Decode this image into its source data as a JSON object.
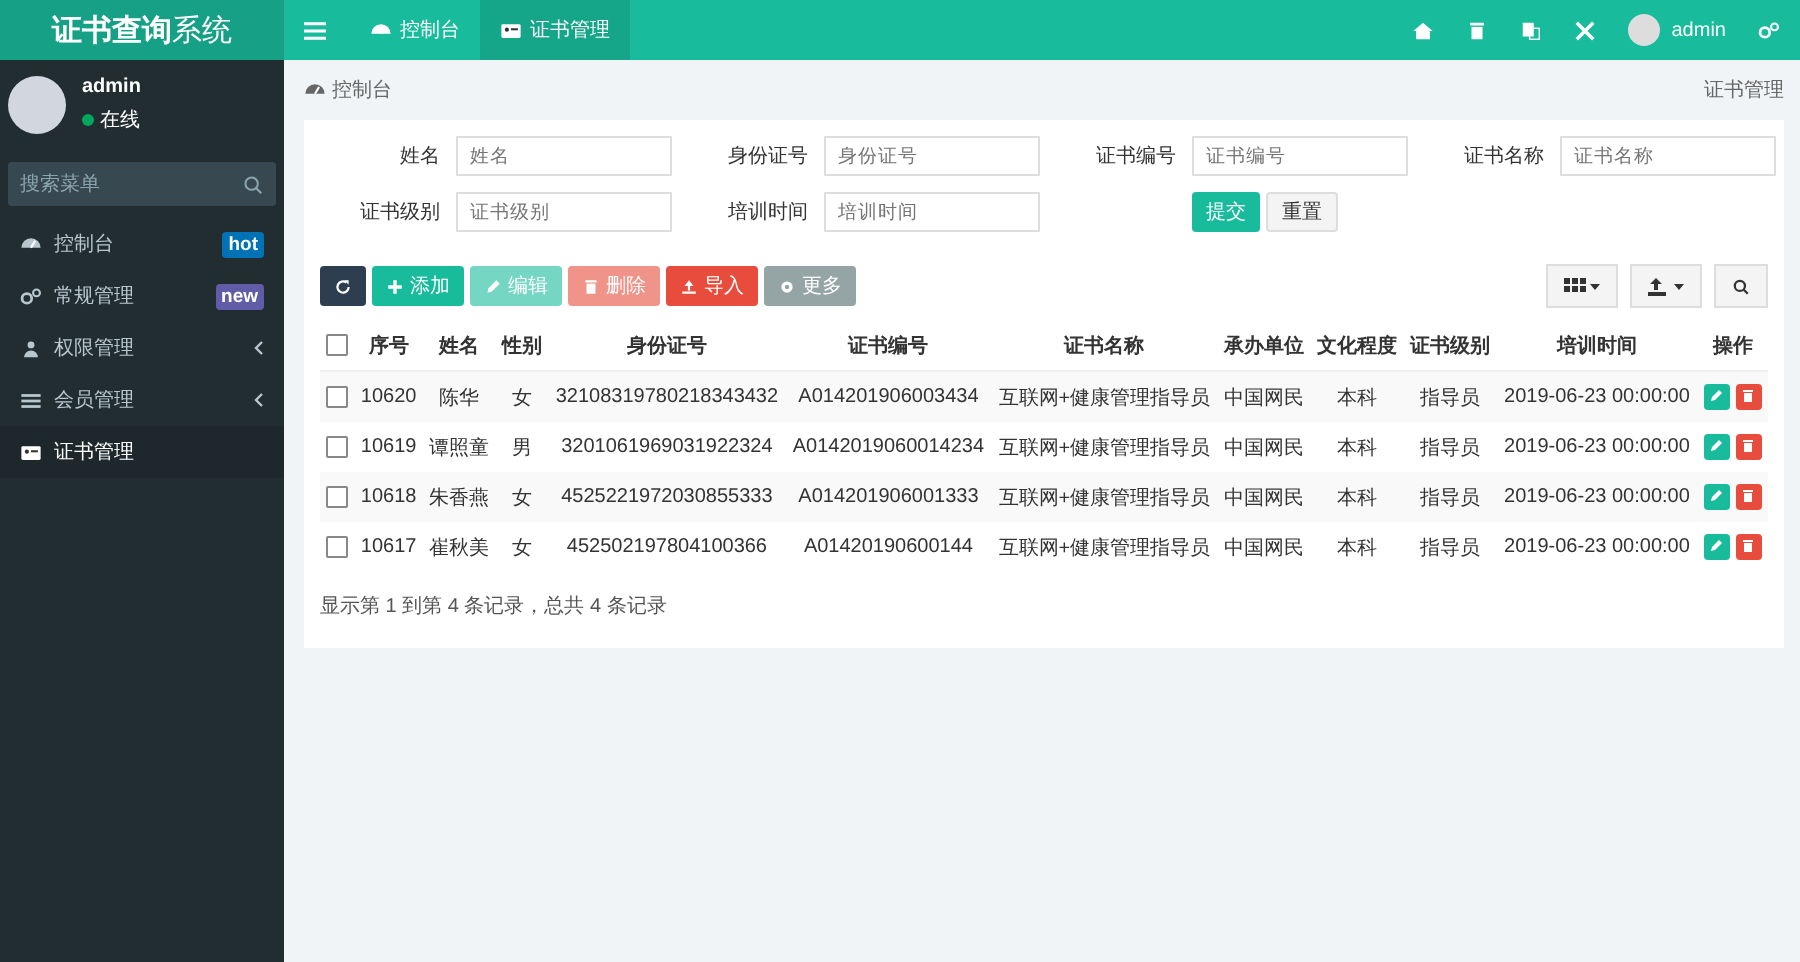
{
  "logo": "**证书查询**系统",
  "header": {
    "tabs": [
      {
        "label": "控制台",
        "selected": false
      },
      {
        "label": "证书管理",
        "selected": true
      }
    ],
    "user": "admin"
  },
  "sidebar": {
    "user": {
      "name": "admin",
      "status": "在线"
    },
    "search": {
      "placeholder": "搜索菜单"
    },
    "items": [
      {
        "label": "控制台",
        "badge": {
          "text": "hot",
          "color": "#0073b7"
        },
        "expandable": false,
        "selected": false
      },
      {
        "label": "常规管理",
        "badge": {
          "text": "new",
          "color": "#605ca8"
        },
        "expandable": false,
        "selected": false
      },
      {
        "label": "权限管理",
        "expandable": true,
        "selected": false
      },
      {
        "label": "会员管理",
        "expandable": true,
        "selected": false
      },
      {
        "label": "证书管理",
        "expandable": false,
        "selected": true
      }
    ]
  },
  "breadcrumb": {
    "current": "控制台",
    "right": "证书管理"
  },
  "filter": {
    "fields": [
      {
        "label": "姓名",
        "placeholder": "姓名"
      },
      {
        "label": "身份证号",
        "placeholder": "身份证号"
      },
      {
        "label": "证书编号",
        "placeholder": "证书编号"
      },
      {
        "label": "证书名称",
        "placeholder": "证书名称"
      },
      {
        "label": "证书级别",
        "placeholder": "证书级别"
      },
      {
        "label": "培训时间",
        "placeholder": "培训时间"
      }
    ],
    "submit": "提交",
    "reset": "重置"
  },
  "toolbar": [
    {
      "kind": "refresh",
      "disabled": false
    },
    {
      "kind": "add",
      "label": "添加",
      "disabled": false
    },
    {
      "kind": "edit",
      "label": "编辑",
      "disabled": true
    },
    {
      "kind": "delete",
      "label": "删除",
      "disabled": true
    },
    {
      "kind": "import",
      "label": "导入",
      "disabled": false
    },
    {
      "kind": "more",
      "label": "更多",
      "disabled": false
    }
  ],
  "table": {
    "all_checked": false,
    "columns": [
      "序号",
      "姓名",
      "性别",
      "身份证号",
      "证书编号",
      "证书名称",
      "承办单位",
      "文化程度",
      "证书级别",
      "培训时间",
      "操作"
    ],
    "rows": [
      {
        "checked": false,
        "cells": [
          "10620",
          "陈华",
          "女",
          "32108319780218343432",
          "A014201906003434",
          "互联网+健康管理指导员",
          "中国网民",
          "本科",
          "指导员",
          "2019-06-23 00:00:00"
        ]
      },
      {
        "checked": false,
        "cells": [
          "10619",
          "谭照童",
          "男",
          "3201061969031922324",
          "A0142019060014234",
          "互联网+健康管理指导员",
          "中国网民",
          "本科",
          "指导员",
          "2019-06-23 00:00:00"
        ]
      },
      {
        "checked": false,
        "cells": [
          "10618",
          "朱香燕",
          "女",
          "4525221972030855333",
          "A014201906001333",
          "互联网+健康管理指导员",
          "中国网民",
          "本科",
          "指导员",
          "2019-06-23 00:00:00"
        ]
      },
      {
        "checked": false,
        "cells": [
          "10617",
          "崔秋美",
          "女",
          "452502197804100366",
          "A01420190600144",
          "互联网+健康管理指导员",
          "中国网民",
          "本科",
          "指导员",
          "2019-06-23 00:00:00"
        ]
      }
    ]
  },
  "pagination": "显示第 1 到第 4 条记录，总共 4 条记录"
}
